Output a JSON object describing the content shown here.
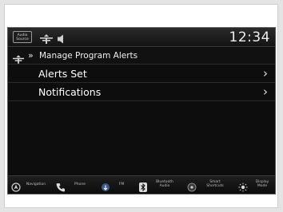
{
  "status_bar": {
    "audio_source_label": "Audio\nSource",
    "clock": "12:34"
  },
  "header": {
    "breadcrumb_separator": "»",
    "title": "Manage Program Alerts"
  },
  "menu": {
    "items": [
      {
        "label": "Alerts Set",
        "chevron": "›"
      },
      {
        "label": "Notifications",
        "chevron": "›"
      }
    ]
  },
  "bottom_nav": {
    "items": [
      {
        "label": "Navigation",
        "icon": "navigation-icon"
      },
      {
        "label": "Phone",
        "icon": "phone-icon"
      },
      {
        "label": "FM",
        "icon": "fm-radio-icon"
      },
      {
        "label": "Bluetooth\nAudio",
        "icon": "bluetooth-icon"
      },
      {
        "label": "Smart\nShortcuts",
        "icon": "smart-shortcuts-icon"
      },
      {
        "label": "Display\nMode",
        "icon": "display-mode-icon"
      }
    ]
  },
  "colors": {
    "screen_background": "#0d0d0d",
    "text_primary": "#ffffff",
    "frame_background": "#e4e4e4"
  }
}
